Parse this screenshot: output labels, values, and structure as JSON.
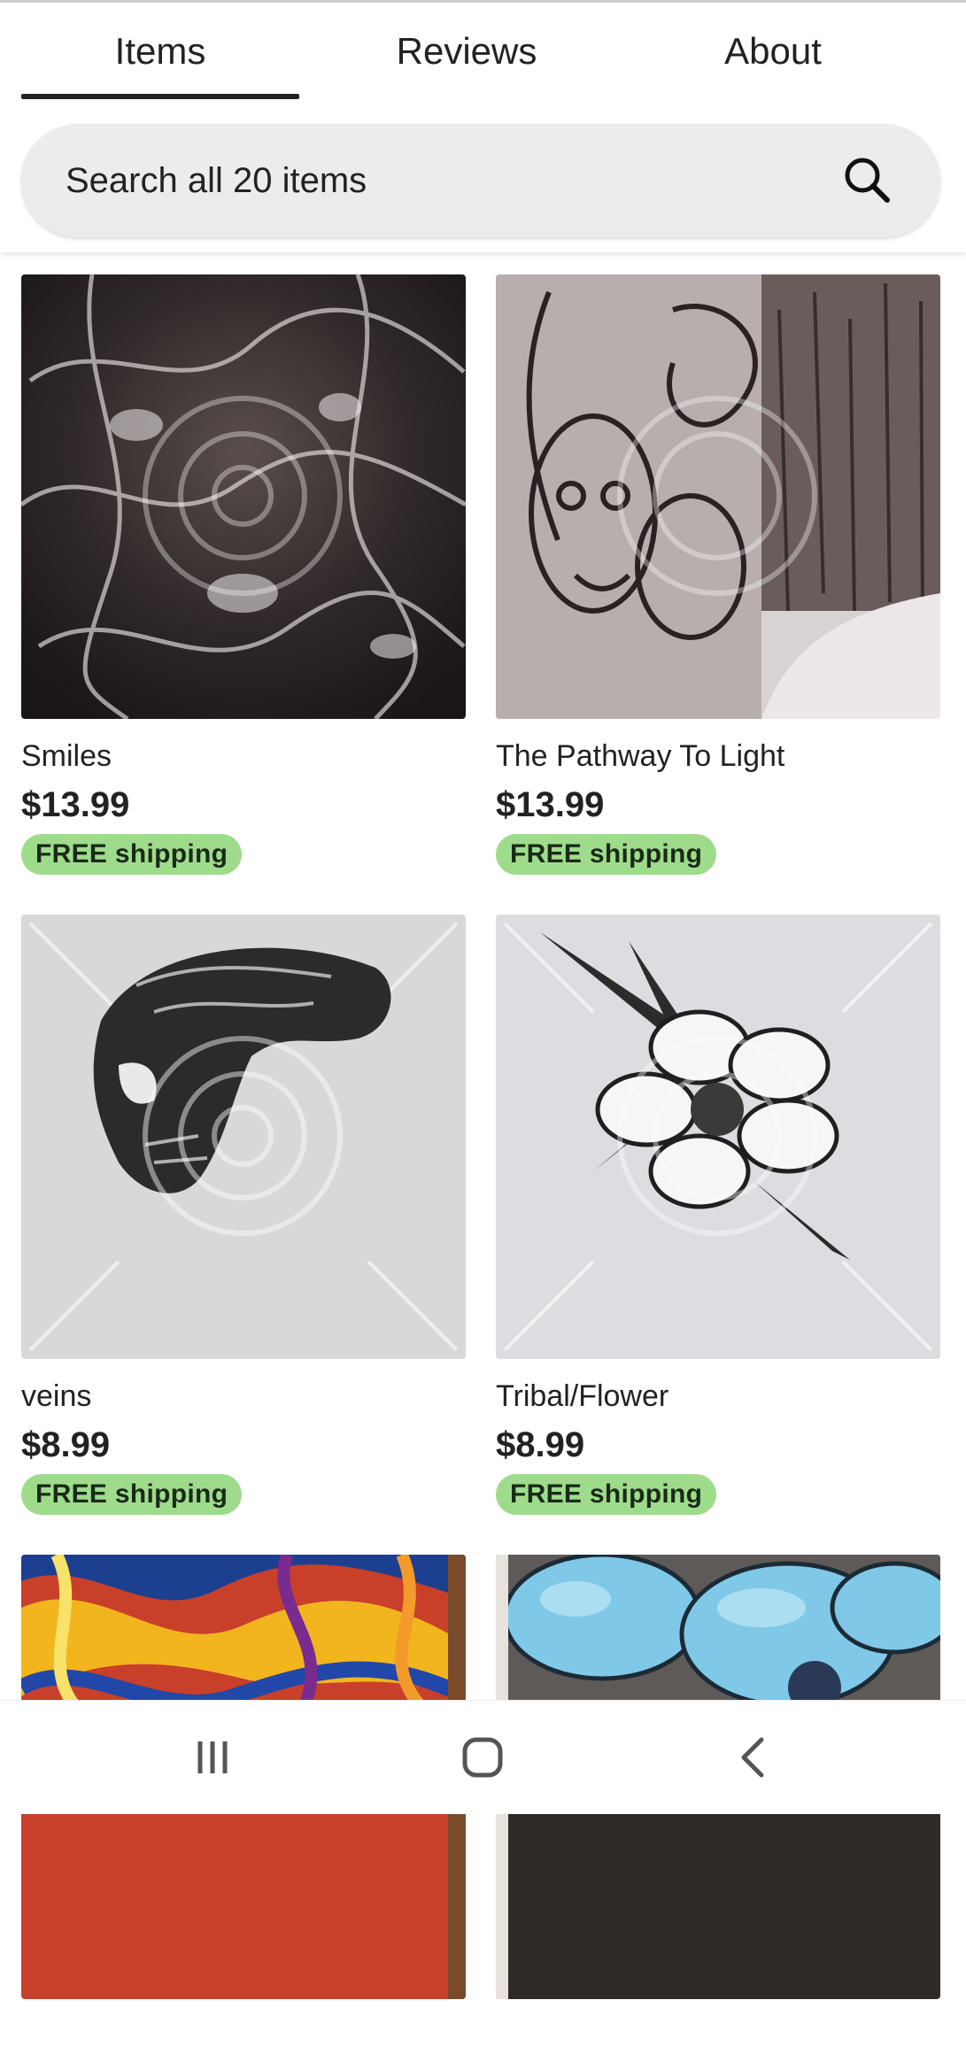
{
  "tabs": {
    "items": "Items",
    "reviews": "Reviews",
    "about": "About",
    "active": "Items"
  },
  "search": {
    "placeholder": "Search all 20 items"
  },
  "listings": [
    {
      "title": "Smiles",
      "price": "$13.99",
      "shipping": "FREE shipping",
      "image": "ink-drawing-smiles"
    },
    {
      "title": "The Pathway To Light",
      "price": "$13.99",
      "shipping": "FREE shipping",
      "image": "ink-drawing-pathway"
    },
    {
      "title": "veins",
      "price": "$8.99",
      "shipping": "FREE shipping",
      "image": "ink-drawing-skull"
    },
    {
      "title": "Tribal/Flower",
      "price": "$8.99",
      "shipping": "FREE shipping",
      "image": "ink-drawing-flower"
    },
    {
      "title": "",
      "price": "",
      "shipping": "",
      "image": "color-psychedelic-painting"
    },
    {
      "title": "",
      "price": "",
      "shipping": "",
      "image": "blue-flower-painting"
    }
  ],
  "colors": {
    "badge_bg": "#9edc8c",
    "search_bg": "#ececec",
    "text": "#222222"
  },
  "navbar": {
    "icons": [
      "recent-apps-icon",
      "home-icon",
      "back-icon"
    ]
  }
}
